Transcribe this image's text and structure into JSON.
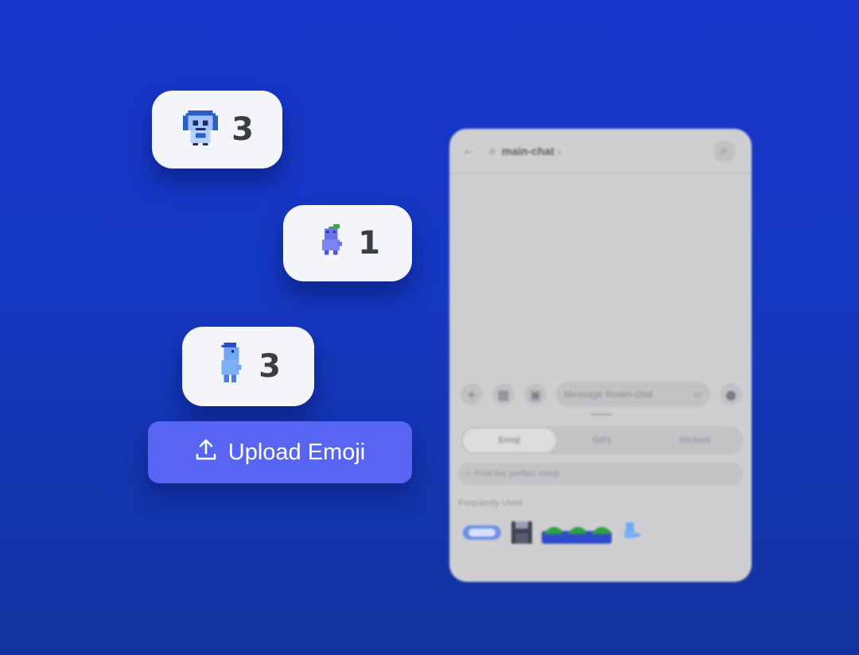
{
  "reactions": [
    {
      "emoji": "blue-headphone-robot-emoji",
      "count": "3"
    },
    {
      "emoji": "purple-creature-leaf-emoji",
      "count": "1"
    },
    {
      "emoji": "blue-dino-cap-emoji",
      "count": "3"
    }
  ],
  "upload_button": {
    "label": "Upload Emoji",
    "icon": "upload-icon"
  },
  "phone": {
    "channel_prefix": "#",
    "channel_name": "main-chat",
    "chevron": "›",
    "composer_placeholder": "Message #main-chat",
    "tabs": [
      "Emoji",
      "GIFs",
      "Stickers"
    ],
    "search_placeholder": "Find the perfect emoji",
    "frequently_used_label": "Frequently Used"
  },
  "colors": {
    "accent": "#5865f2",
    "background": "#1538c3",
    "pill": "#f4f5f9"
  }
}
